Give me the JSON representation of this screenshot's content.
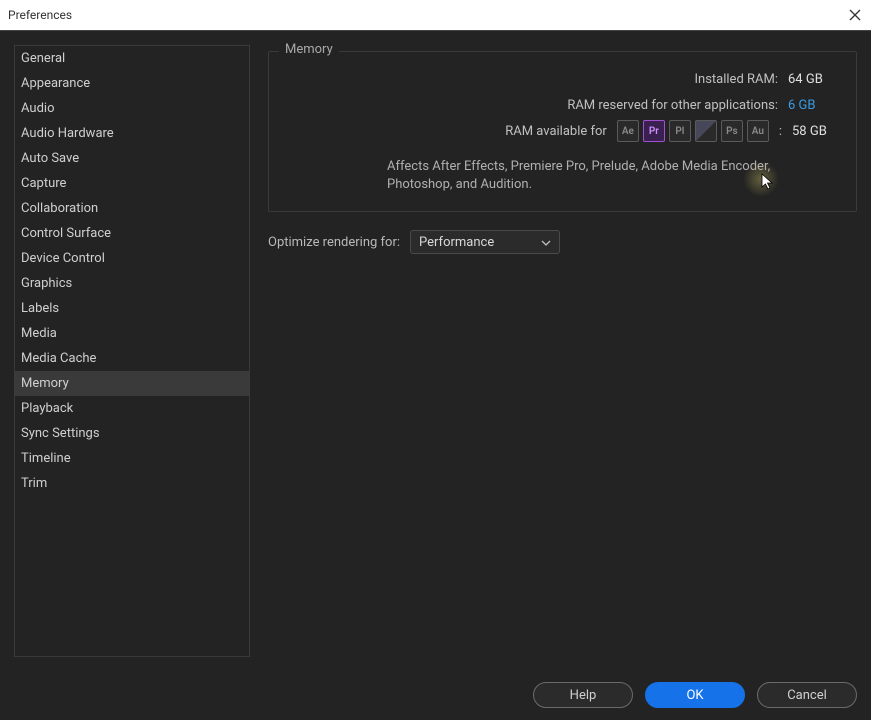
{
  "window": {
    "title": "Preferences"
  },
  "sidebar": {
    "items": [
      {
        "label": "General"
      },
      {
        "label": "Appearance"
      },
      {
        "label": "Audio"
      },
      {
        "label": "Audio Hardware"
      },
      {
        "label": "Auto Save"
      },
      {
        "label": "Capture"
      },
      {
        "label": "Collaboration"
      },
      {
        "label": "Control Surface"
      },
      {
        "label": "Device Control"
      },
      {
        "label": "Graphics"
      },
      {
        "label": "Labels"
      },
      {
        "label": "Media"
      },
      {
        "label": "Media Cache"
      },
      {
        "label": "Memory",
        "selected": true
      },
      {
        "label": "Playback"
      },
      {
        "label": "Sync Settings"
      },
      {
        "label": "Timeline"
      },
      {
        "label": "Trim"
      }
    ]
  },
  "memory": {
    "panel_title": "Memory",
    "installed_label": "Installed RAM:",
    "installed_value": "64 GB",
    "reserved_label": "RAM reserved for other applications:",
    "reserved_value": "6 GB",
    "available_label": "RAM available for",
    "available_suffix": ":",
    "available_value": "58 GB",
    "apps": [
      {
        "code": "Ae",
        "name": "after-effects"
      },
      {
        "code": "Pr",
        "name": "premiere-pro",
        "active": true
      },
      {
        "code": "Pl",
        "name": "prelude"
      },
      {
        "code": "",
        "name": "media-encoder",
        "me": true
      },
      {
        "code": "Ps",
        "name": "photoshop"
      },
      {
        "code": "Au",
        "name": "audition"
      }
    ],
    "note": "Affects After Effects, Premiere Pro, Prelude, Adobe Media Encoder, Photoshop, and Audition."
  },
  "optimize": {
    "label": "Optimize rendering for:",
    "value": "Performance"
  },
  "buttons": {
    "help": "Help",
    "ok": "OK",
    "cancel": "Cancel"
  }
}
